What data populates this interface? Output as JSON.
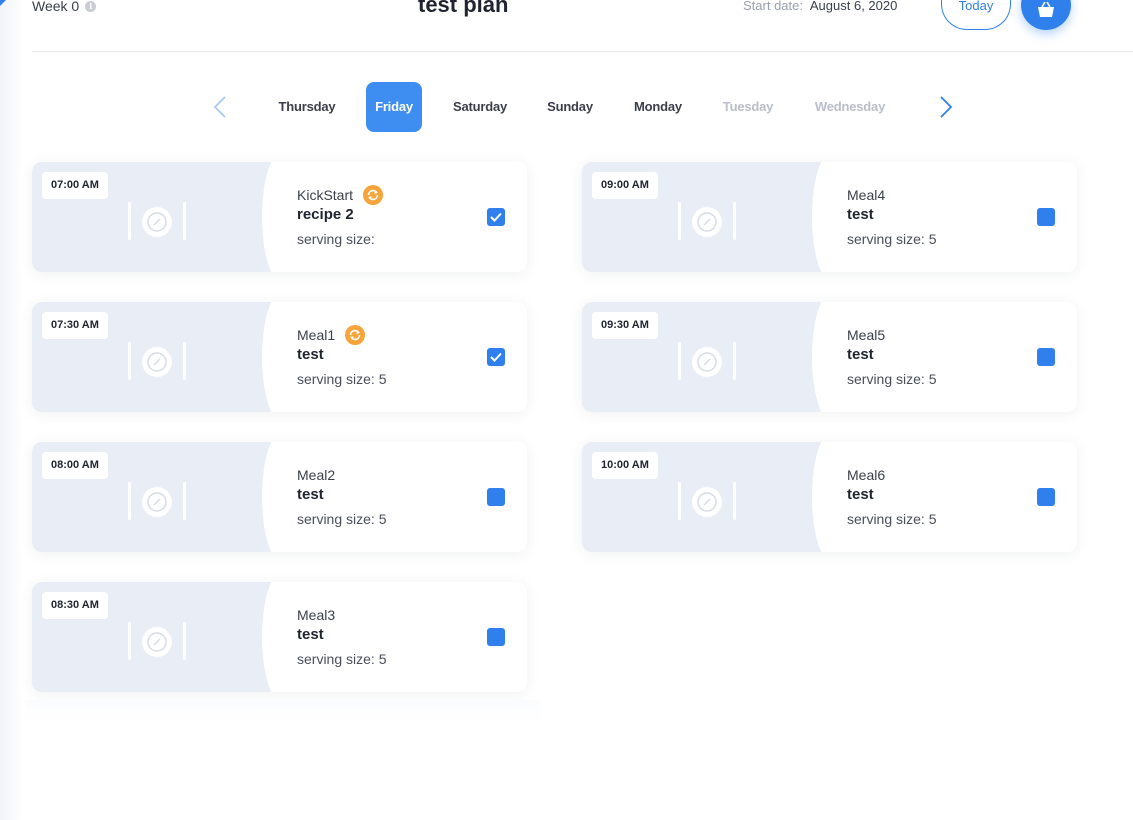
{
  "header": {
    "week_label": "Week 0",
    "info_icon": "info-icon",
    "title": "test plan",
    "start_date_label": "Start date:",
    "start_date_value": "August 6, 2020",
    "today_label": "Today",
    "cart_icon": "basket-icon"
  },
  "colors": {
    "accent": "#2f80ed",
    "swap": "#f7a43a",
    "card_image_bg": "#e9edf5"
  },
  "days": {
    "prev_icon": "chevron-left-icon",
    "next_icon": "chevron-right-icon",
    "items": [
      {
        "label": "Thursday",
        "state": "normal"
      },
      {
        "label": "Friday",
        "state": "active"
      },
      {
        "label": "Saturday",
        "state": "normal"
      },
      {
        "label": "Sunday",
        "state": "normal"
      },
      {
        "label": "Monday",
        "state": "normal"
      },
      {
        "label": "Tuesday",
        "state": "muted"
      },
      {
        "label": "Wednesday",
        "state": "muted"
      }
    ]
  },
  "meals": {
    "left": [
      {
        "time": "07:00 AM",
        "name": "KickStart",
        "recipe": "recipe 2",
        "serving": "serving size:",
        "swap": true,
        "checked": true
      },
      {
        "time": "07:30 AM",
        "name": "Meal1",
        "recipe": "test",
        "serving": "serving size: 5",
        "swap": true,
        "checked": true
      },
      {
        "time": "08:00 AM",
        "name": "Meal2",
        "recipe": "test",
        "serving": "serving size: 5",
        "swap": false,
        "checked": false
      },
      {
        "time": "08:30 AM",
        "name": "Meal3",
        "recipe": "test",
        "serving": "serving size: 5",
        "swap": false,
        "checked": false
      }
    ],
    "right": [
      {
        "time": "09:00 AM",
        "name": "Meal4",
        "recipe": "test",
        "serving": "serving size: 5",
        "swap": false,
        "checked": false
      },
      {
        "time": "09:30 AM",
        "name": "Meal5",
        "recipe": "test",
        "serving": "serving size: 5",
        "swap": false,
        "checked": false
      },
      {
        "time": "10:00 AM",
        "name": "Meal6",
        "recipe": "test",
        "serving": "serving size: 5",
        "swap": false,
        "checked": false
      }
    ]
  }
}
